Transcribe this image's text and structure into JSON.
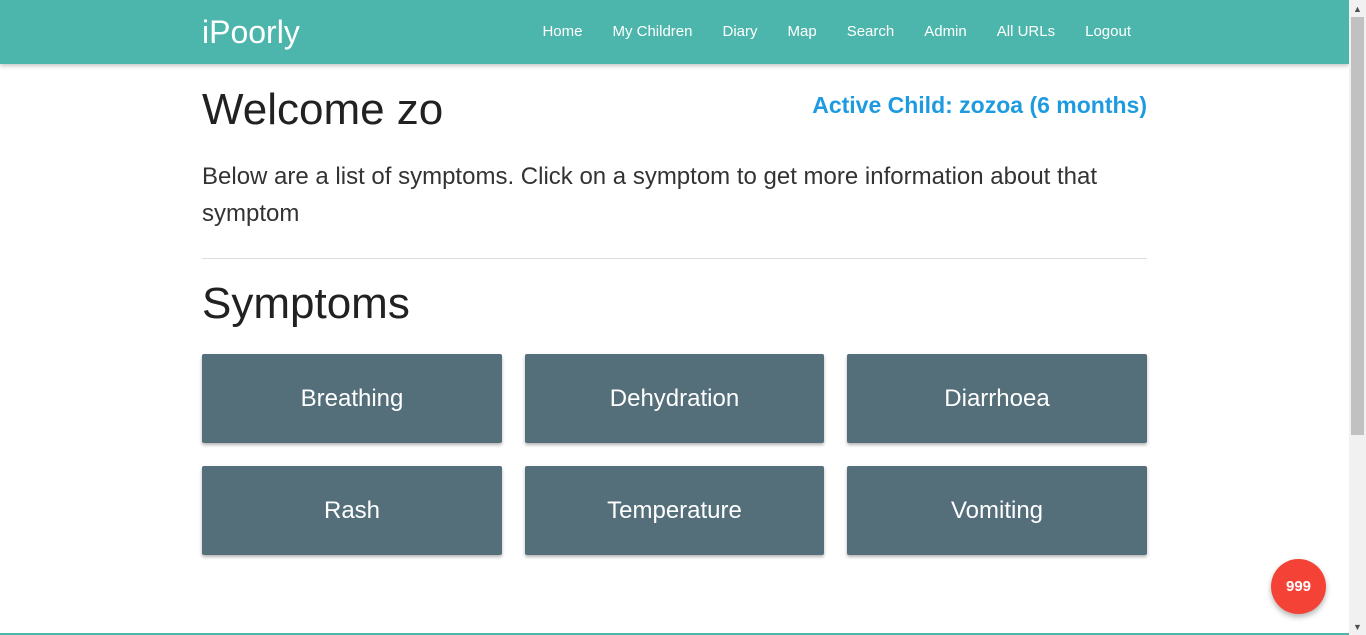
{
  "navbar": {
    "brand": "iPoorly",
    "links": [
      {
        "label": "Home"
      },
      {
        "label": "My Children"
      },
      {
        "label": "Diary"
      },
      {
        "label": "Map"
      },
      {
        "label": "Search"
      },
      {
        "label": "Admin"
      },
      {
        "label": "All URLs"
      },
      {
        "label": "Logout"
      }
    ]
  },
  "main": {
    "welcome": "Welcome zo",
    "active_child": "Active Child: zozoa (6 months)",
    "intro": "Below are a list of symptoms. Click on a symptom to get more information about that symptom",
    "section_title": "Symptoms",
    "symptoms": [
      {
        "label": "Breathing"
      },
      {
        "label": "Dehydration"
      },
      {
        "label": "Diarrhoea"
      },
      {
        "label": "Rash"
      },
      {
        "label": "Temperature"
      },
      {
        "label": "Vomiting"
      }
    ]
  },
  "fab": {
    "label": "999"
  },
  "colors": {
    "navbar": "#4db6ac",
    "symptom_button": "#546e7a",
    "active_child": "#1e9be0",
    "fab": "#f44336"
  },
  "icons": {
    "scroll_up": "chevron-up-icon",
    "scroll_down": "chevron-down-icon"
  }
}
